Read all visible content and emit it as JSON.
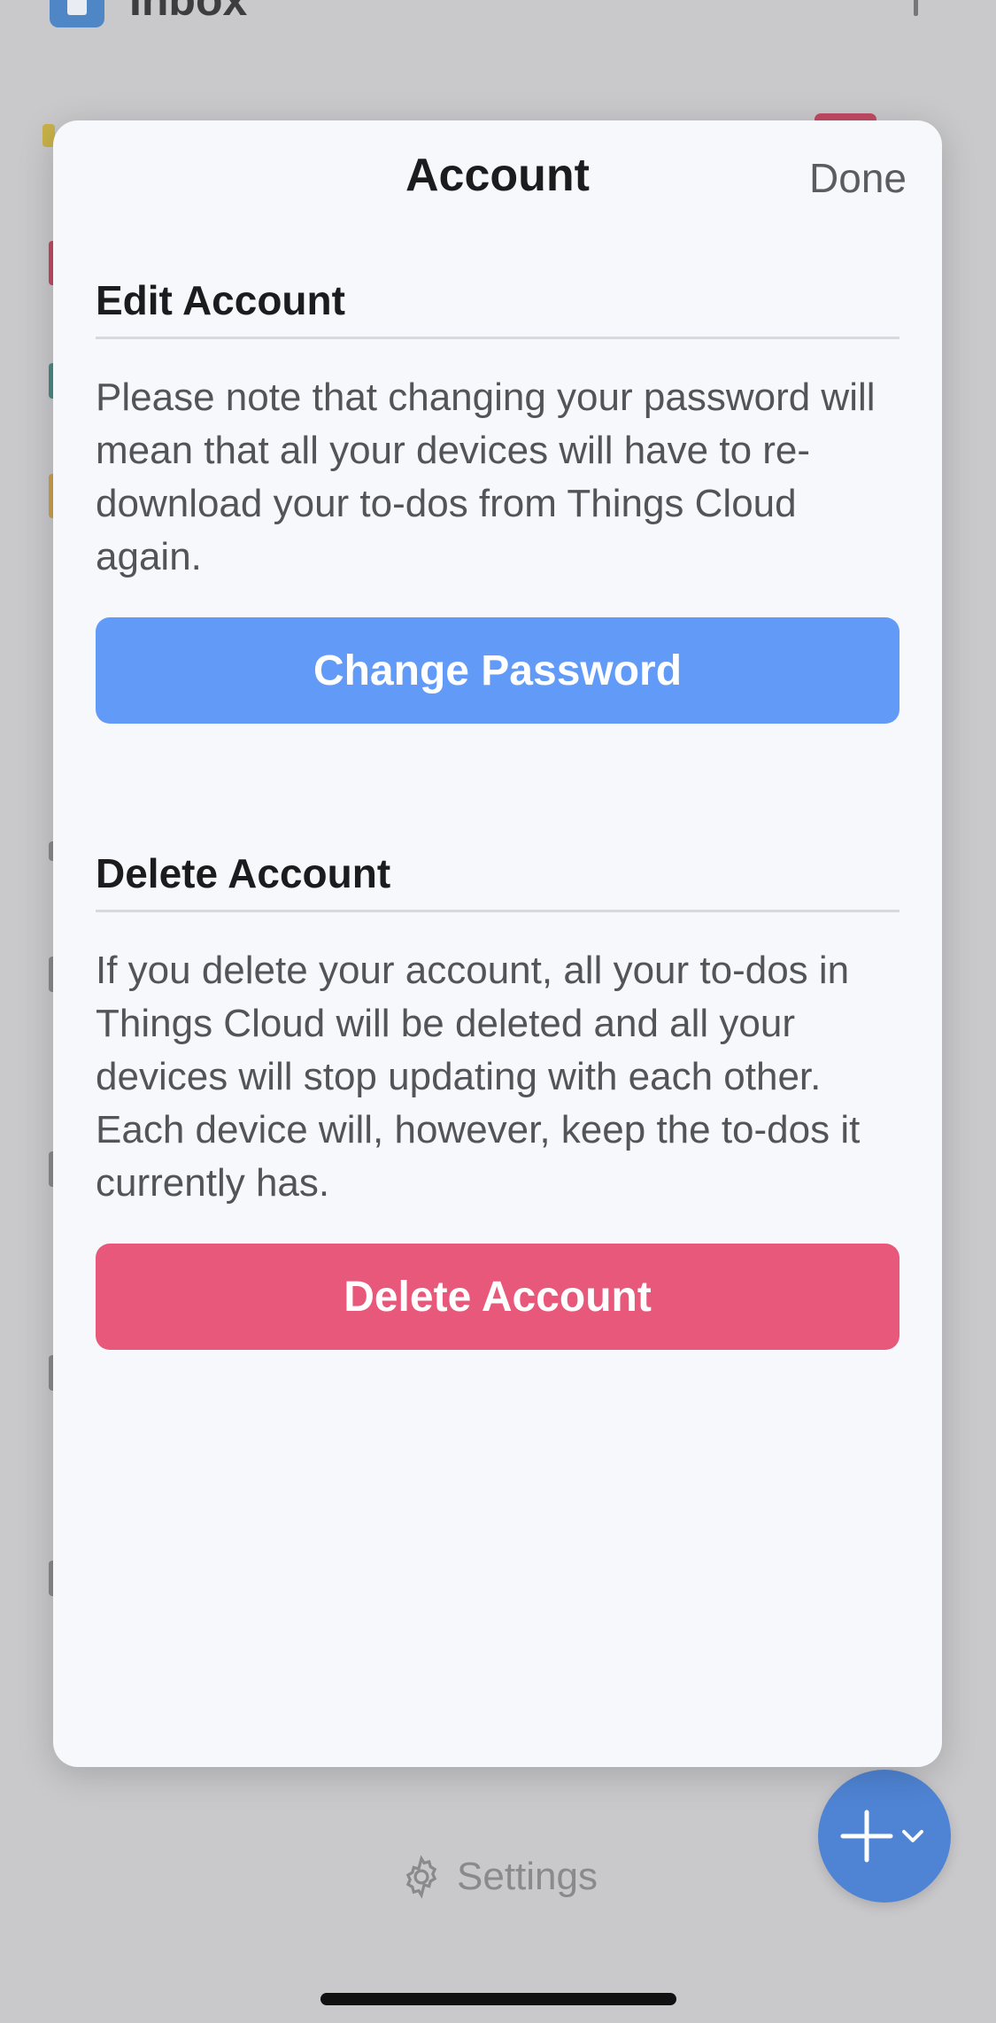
{
  "background": {
    "inbox_label": "Inbox",
    "settings_label": "Settings"
  },
  "sheet": {
    "title": "Account",
    "done_label": "Done",
    "edit": {
      "heading": "Edit Account",
      "body": "Please note that changing your password will mean that all your devices will have to re-download your to-dos from Things Cloud again.",
      "button_label": "Change Password"
    },
    "delete": {
      "heading": "Delete Account",
      "body": "If you delete your account, all your to-dos in Things Cloud will be deleted and all your devices will stop updating with each other. Each device will, however, keep the to-dos it currently has.",
      "button_label": "Delete Account"
    }
  },
  "icons": {
    "settings": "gear-icon",
    "add": "plus-icon",
    "chevron": "chevron-down-icon"
  },
  "colors": {
    "primary_button": "#629bf7",
    "destructive_button": "#e8587a",
    "fab": "#4f84d4",
    "sheet_background": "#f6f8fb"
  }
}
